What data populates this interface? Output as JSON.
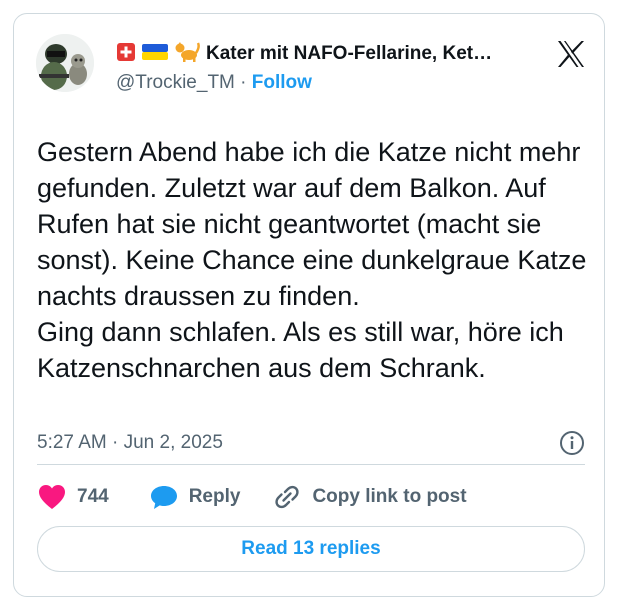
{
  "author": {
    "display_name": "Kater mit NAFO-Fellarine, Ket…",
    "handle": "@Trockie_TM",
    "separator": "·",
    "follow_label": "Follow"
  },
  "tweet": {
    "paragraphs": [
      "Gestern Abend habe ich die Katze nicht mehr gefunden. Zuletzt war auf dem Balkon. Auf Rufen hat sie nicht geantwortet (macht sie sonst). Keine Chance eine dunkelgraue Katze nachts draussen zu finden.",
      "Ging dann schlafen. Als es still war, höre ich Katzenschnarchen aus dem Schrank."
    ],
    "timestamp": "5:27 AM · Jun 2, 2025"
  },
  "actions": {
    "like_count": "744",
    "reply_label": "Reply",
    "copy_label": "Copy link to post"
  },
  "read_replies_label": "Read 13 replies",
  "colors": {
    "accent": "#1d9bf0",
    "like": "#f91880",
    "text": "#0f1419",
    "muted": "#536471",
    "border": "#cfd9de"
  },
  "icons": [
    "x-logo-icon",
    "swiss-flag-icon",
    "ukraine-flag-icon",
    "cat-icon",
    "info-icon",
    "heart-icon",
    "reply-bubble-icon",
    "link-icon"
  ]
}
